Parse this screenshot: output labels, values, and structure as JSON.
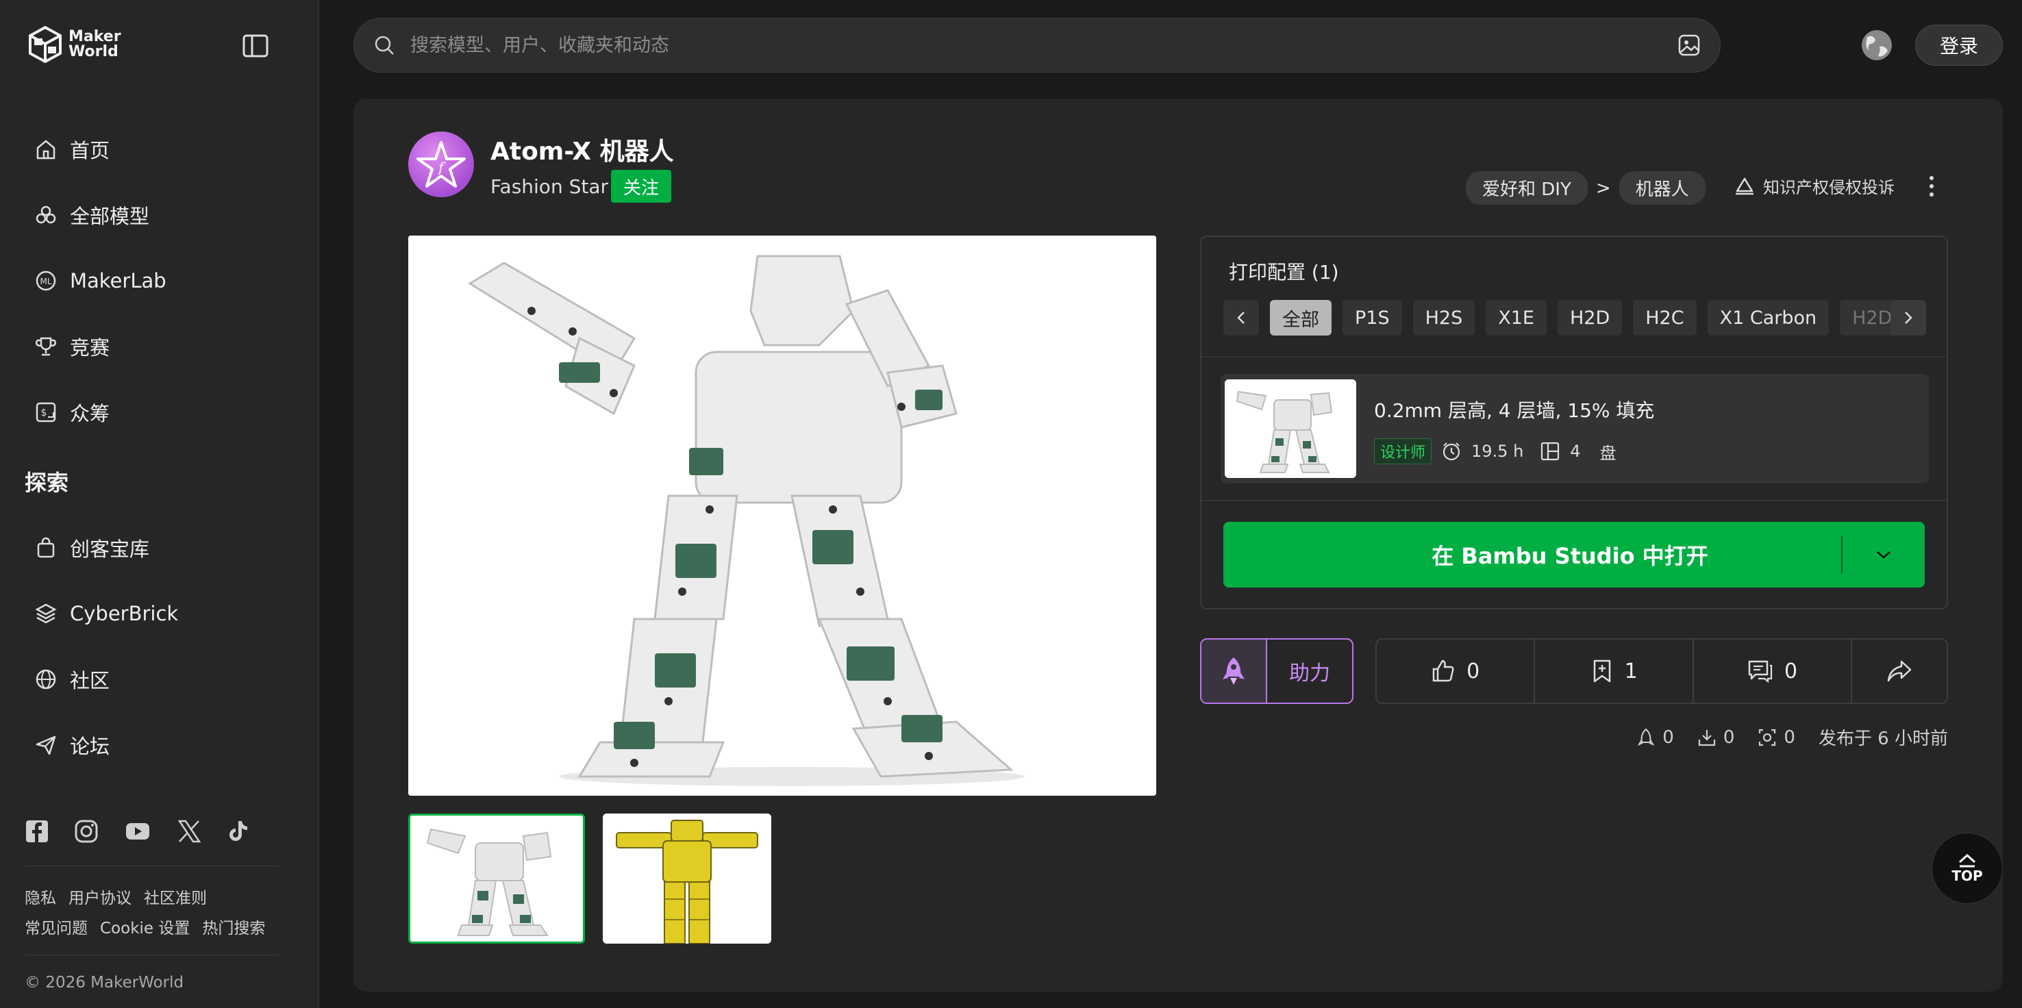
{
  "brand": {
    "name_line1": "Maker",
    "name_line2": "World"
  },
  "sidebar": {
    "items": [
      {
        "label": "首页",
        "icon": "home-icon"
      },
      {
        "label": "全部模型",
        "icon": "models-icon"
      },
      {
        "label": "MakerLab",
        "icon": "makerlab-icon"
      },
      {
        "label": "竞赛",
        "icon": "trophy-icon"
      },
      {
        "label": "众筹",
        "icon": "crowdfund-icon"
      }
    ],
    "section_title": "探索",
    "explore_items": [
      {
        "label": "创客宝库",
        "icon": "bag-icon"
      },
      {
        "label": "CyberBrick",
        "icon": "cyberbrick-icon"
      },
      {
        "label": "社区",
        "icon": "globe-icon"
      },
      {
        "label": "论坛",
        "icon": "send-icon"
      }
    ],
    "social": [
      "facebook-icon",
      "instagram-icon",
      "youtube-icon",
      "x-icon",
      "tiktok-icon"
    ],
    "footer_links_1": [
      "隐私",
      "用户协议",
      "社区准则"
    ],
    "footer_links_2": [
      "常见问题",
      "Cookie 设置",
      "热门搜索"
    ],
    "copyright": "© 2026 MakerWorld"
  },
  "header": {
    "search_placeholder": "搜索模型、用户、收藏夹和动态",
    "login_label": "登录"
  },
  "model": {
    "title": "Atom-X 机器人",
    "author": "Fashion Star",
    "follow_label": "关注",
    "breadcrumb": [
      "爱好和 DIY",
      "机器人"
    ],
    "breadcrumb_sep": ">",
    "report_label": "知识产权侵权投诉"
  },
  "print_config": {
    "title": "打印配置 (1)",
    "filters": [
      "全部",
      "P1S",
      "H2S",
      "X1E",
      "H2D",
      "H2C",
      "X1 Carbon",
      "H2D"
    ],
    "selected_filter": "全部",
    "profile": {
      "name": "0.2mm 层高, 4 层墙, 15% 填充",
      "tag": "设计师",
      "time": "19.5 h",
      "plates": "4",
      "plates_unit": "盘"
    },
    "open_label": "在 Bambu Studio 中打开"
  },
  "engagement": {
    "boost_label": "助力",
    "likes": "0",
    "collects": "1",
    "comments": "0"
  },
  "stats": {
    "boosts": "0",
    "downloads": "0",
    "prints": "0",
    "published": "发布于 6 小时前"
  },
  "back_to_top": "TOP",
  "colors": {
    "accent": "#00ae42",
    "boost": "#b777e8",
    "background": "#1a1a1a",
    "panel": "#262626"
  }
}
